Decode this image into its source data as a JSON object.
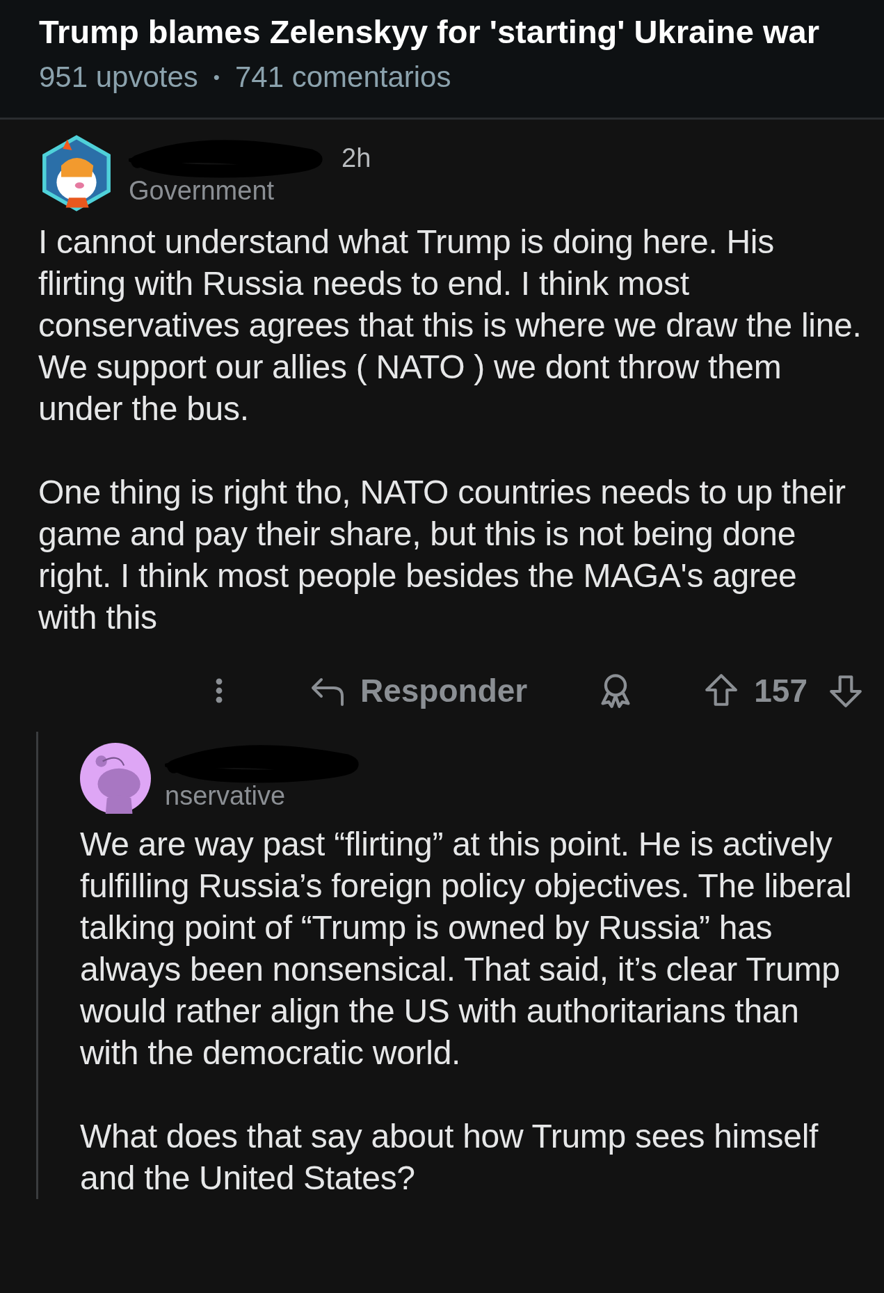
{
  "post": {
    "title": "Trump blames Zelenskyy for 'starting' Ukraine war",
    "upvotes": "951 upvotes",
    "separator": "•",
    "comments": "741 comentarios"
  },
  "comments": [
    {
      "time": "2h",
      "flair": "Government",
      "kind": "hexagon",
      "paragraphs": [
        "I cannot understand what Trump is doing here. His flirting with Russia needs to end. I think most conservatives agrees that this is where we draw the line. We support our allies ( NATO ) we dont throw them under the bus.",
        "One thing is right tho, NATO countries needs to up their game and pay their share, but this is not being done right. I think most people besides the MAGA's agree with this"
      ],
      "actions": {
        "reply": "Responder",
        "score": "157"
      }
    },
    {
      "flair": "nservative",
      "kind": "circle",
      "paragraphs": [
        "We are way past “flirting” at this point. He is actively fulfilling Russia’s foreign policy objectives. The liberal talking point of “Trump is owned by Russia” has always been nonsensical. That said, it’s clear Trump would rather align the US with authoritarians than with the democratic world.",
        "What does that say about how Trump sees himself and the United States?"
      ]
    }
  ]
}
